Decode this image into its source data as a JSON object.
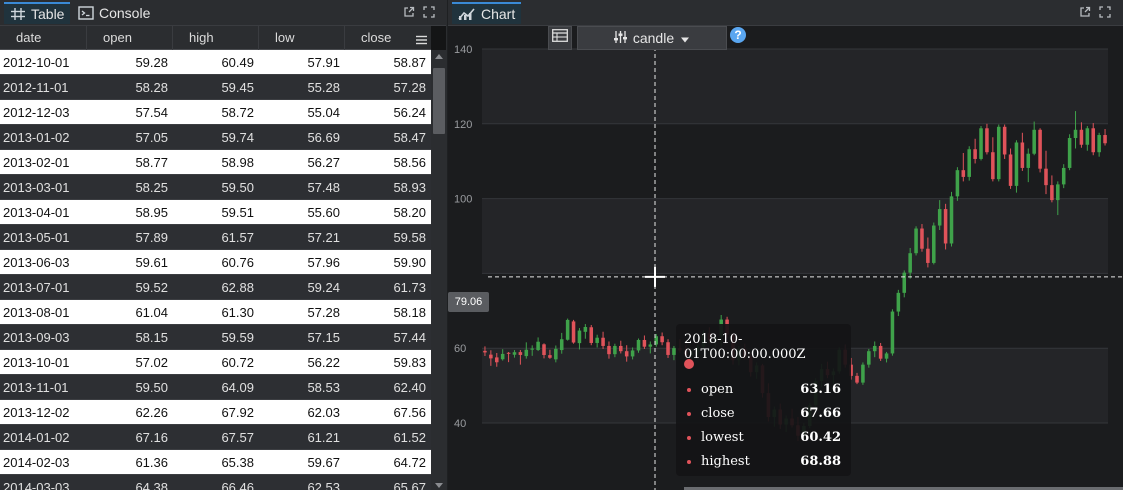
{
  "left_panel": {
    "tabs": [
      {
        "label": "Table",
        "icon": "grid-icon"
      },
      {
        "label": "Console",
        "icon": "terminal-icon"
      }
    ],
    "columns": [
      "date",
      "open",
      "high",
      "low",
      "close"
    ],
    "rows": [
      [
        "2012-10-01",
        "59.28",
        "60.49",
        "57.91",
        "58.87"
      ],
      [
        "2012-11-01",
        "58.28",
        "59.45",
        "55.28",
        "57.28"
      ],
      [
        "2012-12-03",
        "57.54",
        "58.72",
        "55.04",
        "56.24"
      ],
      [
        "2013-01-02",
        "57.05",
        "59.74",
        "56.69",
        "58.47"
      ],
      [
        "2013-02-01",
        "58.77",
        "58.98",
        "56.27",
        "58.56"
      ],
      [
        "2013-03-01",
        "58.25",
        "59.50",
        "57.48",
        "58.93"
      ],
      [
        "2013-04-01",
        "58.95",
        "59.51",
        "55.60",
        "58.20"
      ],
      [
        "2013-05-01",
        "57.89",
        "61.57",
        "57.21",
        "59.58"
      ],
      [
        "2013-06-03",
        "59.61",
        "60.76",
        "57.96",
        "59.90"
      ],
      [
        "2013-07-01",
        "59.52",
        "62.88",
        "59.24",
        "61.73"
      ],
      [
        "2013-08-01",
        "61.04",
        "61.30",
        "57.28",
        "58.18"
      ],
      [
        "2013-09-03",
        "58.15",
        "59.59",
        "57.15",
        "57.44"
      ],
      [
        "2013-10-01",
        "57.02",
        "60.72",
        "56.22",
        "59.83"
      ],
      [
        "2013-11-01",
        "59.50",
        "64.09",
        "58.53",
        "62.40"
      ],
      [
        "2013-12-02",
        "62.26",
        "67.92",
        "62.03",
        "67.56"
      ],
      [
        "2014-01-02",
        "67.16",
        "67.57",
        "61.21",
        "61.52"
      ],
      [
        "2014-02-03",
        "61.36",
        "65.38",
        "59.67",
        "64.72"
      ],
      [
        "2014-03-03",
        "64.38",
        "66.46",
        "62.53",
        "65.67"
      ]
    ]
  },
  "right_panel": {
    "tab": {
      "label": "Chart",
      "icon": "chart-icon"
    },
    "toolbar": {
      "chart_type": "candle",
      "help": "?"
    },
    "crosshair_value": "79.06",
    "tooltip": {
      "title": "2018-10-01T00:00:00.000Z",
      "rows": [
        {
          "key": "open",
          "value": "63.16"
        },
        {
          "key": "close",
          "value": "67.66"
        },
        {
          "key": "lowest",
          "value": "60.42"
        },
        {
          "key": "highest",
          "value": "68.88"
        }
      ]
    }
  },
  "colors": {
    "up": "#3fa24a",
    "down": "#e0535a",
    "accent": "#3a8ad6"
  },
  "chart_data": {
    "type": "candlestick",
    "ylim": [
      30,
      140
    ],
    "yticks": [
      "140",
      "120",
      "100",
      "60",
      "40"
    ],
    "grid": true,
    "series": [
      {
        "name": "ohlc",
        "values": [
          [
            59.28,
            60.49,
            57.91,
            58.87
          ],
          [
            58.28,
            59.45,
            55.28,
            57.28
          ],
          [
            57.54,
            58.72,
            55.04,
            56.24
          ],
          [
            57.05,
            59.74,
            56.69,
            58.47
          ],
          [
            58.77,
            58.98,
            56.27,
            58.56
          ],
          [
            58.25,
            59.5,
            57.48,
            58.93
          ],
          [
            58.95,
            59.51,
            55.6,
            58.2
          ],
          [
            57.89,
            61.57,
            57.21,
            59.58
          ],
          [
            59.61,
            60.76,
            57.96,
            59.9
          ],
          [
            59.52,
            62.88,
            59.24,
            61.73
          ],
          [
            61.04,
            61.3,
            57.28,
            58.18
          ],
          [
            58.15,
            59.59,
            57.15,
            57.44
          ],
          [
            57.02,
            60.72,
            56.22,
            59.83
          ],
          [
            59.5,
            64.09,
            58.53,
            62.4
          ],
          [
            62.26,
            67.92,
            62.03,
            67.56
          ],
          [
            67.16,
            67.57,
            61.21,
            61.52
          ],
          [
            61.36,
            65.38,
            59.67,
            64.72
          ],
          [
            64.38,
            66.46,
            62.53,
            65.67
          ],
          [
            65.6,
            66.2,
            60.8,
            61.4
          ],
          [
            61.4,
            63.6,
            60.2,
            62.8
          ],
          [
            62.8,
            64.4,
            59.8,
            60.6
          ],
          [
            60.6,
            61.8,
            57.2,
            58.4
          ],
          [
            58.4,
            61.2,
            57.6,
            60.6
          ],
          [
            60.6,
            62.0,
            58.6,
            59.2
          ],
          [
            59.2,
            60.8,
            56.4,
            57.8
          ],
          [
            57.8,
            60.2,
            57.0,
            59.4
          ],
          [
            59.4,
            62.6,
            58.8,
            62.2
          ],
          [
            62.2,
            63.4,
            59.8,
            60.4
          ],
          [
            60.4,
            61.8,
            58.6,
            61.0
          ],
          [
            61.0,
            63.8,
            60.4,
            63.2
          ],
          [
            63.2,
            64.2,
            60.8,
            61.6
          ],
          [
            61.6,
            62.4,
            57.4,
            58.2
          ],
          [
            58.2,
            60.6,
            56.8,
            60.0
          ],
          [
            60.0,
            62.4,
            58.8,
            59.4
          ],
          [
            59.4,
            60.8,
            57.0,
            58.0
          ],
          [
            58.0,
            59.6,
            56.6,
            58.8
          ],
          [
            58.8,
            61.0,
            58.0,
            60.4
          ],
          [
            60.4,
            64.8,
            59.8,
            64.0
          ],
          [
            64.0,
            65.6,
            61.4,
            62.2
          ],
          [
            62.2,
            63.6,
            60.2,
            63.0
          ],
          [
            63.16,
            68.88,
            60.42,
            67.66
          ],
          [
            67.66,
            68.4,
            62.8,
            63.6
          ],
          [
            63.6,
            64.0,
            55.6,
            56.8
          ],
          [
            56.8,
            60.6,
            55.4,
            59.8
          ],
          [
            59.8,
            61.2,
            57.0,
            57.8
          ],
          [
            57.8,
            58.6,
            52.4,
            53.6
          ],
          [
            53.6,
            56.2,
            51.8,
            55.4
          ],
          [
            55.4,
            55.8,
            46.8,
            48.0
          ],
          [
            48.0,
            50.6,
            40.4,
            41.6
          ],
          [
            41.6,
            44.4,
            39.0,
            43.6
          ],
          [
            43.6,
            45.2,
            38.4,
            39.6
          ],
          [
            39.6,
            42.0,
            37.6,
            41.2
          ],
          [
            41.2,
            43.8,
            38.8,
            39.4
          ],
          [
            39.4,
            41.6,
            35.2,
            36.6
          ],
          [
            36.6,
            40.0,
            35.8,
            39.2
          ],
          [
            39.2,
            45.4,
            38.6,
            44.8
          ],
          [
            44.8,
            52.0,
            44.0,
            51.2
          ],
          [
            51.2,
            55.8,
            49.6,
            54.4
          ],
          [
            54.4,
            56.4,
            52.0,
            52.8
          ],
          [
            52.8,
            54.6,
            50.4,
            53.8
          ],
          [
            53.8,
            60.2,
            53.2,
            59.6
          ],
          [
            59.6,
            61.0,
            54.8,
            55.6
          ],
          [
            55.6,
            57.4,
            51.6,
            52.6
          ],
          [
            52.6,
            53.4,
            50.4,
            50.8
          ],
          [
            50.8,
            56.2,
            50.2,
            55.6
          ],
          [
            55.6,
            59.8,
            54.8,
            59.2
          ],
          [
            59.2,
            61.8,
            57.6,
            60.6
          ],
          [
            60.6,
            61.4,
            56.6,
            57.2
          ],
          [
            57.2,
            59.0,
            56.2,
            58.6
          ],
          [
            58.6,
            70.4,
            58.0,
            69.8
          ],
          [
            69.8,
            75.6,
            68.6,
            74.8
          ],
          [
            74.8,
            80.8,
            73.6,
            80.2
          ],
          [
            80.2,
            86.8,
            78.6,
            85.4
          ],
          [
            85.4,
            92.6,
            84.8,
            92.0
          ],
          [
            92.0,
            93.2,
            85.8,
            86.6
          ],
          [
            86.6,
            89.6,
            81.6,
            82.8
          ],
          [
            82.8,
            93.6,
            82.4,
            92.8
          ],
          [
            92.8,
            99.6,
            91.6,
            97.2
          ],
          [
            97.2,
            98.6,
            86.4,
            88.0
          ],
          [
            88.0,
            101.8,
            87.2,
            100.6
          ],
          [
            100.6,
            108.4,
            99.4,
            107.6
          ],
          [
            107.6,
            112.2,
            104.6,
            105.8
          ],
          [
            105.8,
            114.0,
            104.8,
            113.2
          ],
          [
            113.2,
            116.0,
            109.4,
            110.6
          ],
          [
            110.6,
            119.4,
            110.2,
            118.8
          ],
          [
            118.8,
            120.0,
            111.8,
            112.4
          ],
          [
            112.4,
            116.4,
            104.6,
            105.2
          ],
          [
            105.2,
            119.8,
            104.6,
            119.2
          ],
          [
            119.2,
            119.8,
            110.6,
            111.8
          ],
          [
            111.8,
            113.4,
            102.6,
            103.4
          ],
          [
            103.4,
            115.6,
            101.6,
            115.0
          ],
          [
            115.0,
            117.6,
            107.4,
            108.2
          ],
          [
            108.2,
            113.4,
            104.4,
            112.0
          ],
          [
            112.0,
            120.6,
            111.6,
            118.4
          ],
          [
            118.4,
            118.8,
            107.0,
            108.0
          ],
          [
            108.0,
            112.8,
            101.2,
            103.6
          ],
          [
            103.6,
            106.2,
            99.0,
            99.6
          ],
          [
            99.6,
            104.6,
            95.6,
            103.8
          ],
          [
            103.8,
            109.2,
            102.8,
            108.2
          ],
          [
            108.2,
            117.2,
            107.6,
            116.2
          ],
          [
            116.2,
            123.4,
            113.4,
            118.4
          ],
          [
            118.4,
            120.4,
            113.6,
            114.4
          ],
          [
            114.4,
            119.4,
            112.8,
            118.8
          ],
          [
            118.8,
            120.2,
            111.6,
            112.4
          ],
          [
            112.4,
            117.6,
            111.2,
            117.0
          ],
          [
            117.0,
            118.6,
            114.2,
            114.8
          ]
        ]
      }
    ]
  }
}
